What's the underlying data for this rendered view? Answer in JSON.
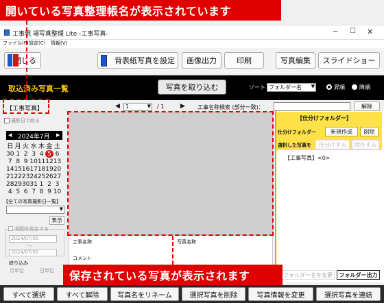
{
  "callouts": {
    "top": "開いている写真整理帳名が表示されています",
    "bottom": "保存されている写真が表示されます"
  },
  "window": {
    "title": "工事現 場写真整理 Lite -工事写真-"
  },
  "menu": [
    "ファイル(F)",
    "設定(C)",
    "情報(V)"
  ],
  "toolbar": {
    "close": "閉じる",
    "set_background": "背表紙写真を設定",
    "image_output": "画像出力",
    "print": "印刷",
    "edit_photo": "写真編集",
    "slideshow": "スライドショー"
  },
  "blackbar": {
    "section_title": "取込済み写真一覧",
    "import_button": "写真を取り込む",
    "sort_label": "ソート",
    "sort_value": "フォルダー名",
    "ascending": "昇順",
    "descending": "降順"
  },
  "filterbar": {
    "album_name": "【工事写真】",
    "page_value": "1",
    "page_total": "/ 1",
    "search_label": "工事名称検索 (部分一致)：",
    "clear_button": "解除"
  },
  "left": {
    "narrow_checkbox": "撮影日で絞る",
    "month": "2024年7月",
    "weekdays": [
      "日",
      "月",
      "火",
      "水",
      "木",
      "金",
      "土"
    ],
    "weeks": [
      [
        "30",
        "1",
        "2",
        "3",
        "4",
        "5",
        "6"
      ],
      [
        "7",
        "8",
        "9",
        "10",
        "11",
        "12",
        "13"
      ],
      [
        "14",
        "15",
        "16",
        "17",
        "18",
        "19",
        "20"
      ],
      [
        "21",
        "22",
        "23",
        "24",
        "25",
        "26",
        "27"
      ],
      [
        "28",
        "29",
        "30",
        "31",
        "1",
        "2",
        "3"
      ],
      [
        "4",
        "5",
        "6",
        "7",
        "8",
        "9",
        "10"
      ]
    ],
    "all_dates_label": "【全ての写真撮影日一覧】",
    "show_button": "表示",
    "period_label": "期間を指定する",
    "date_from": "2024/07/05",
    "tilde": "～",
    "date_to": "2024/07/05",
    "narrow_label": "絞り込み",
    "radio_month": "月単位",
    "radio_day": "日単位"
  },
  "photo_info": {
    "construction_name": "工事名称",
    "photo_name": "写真名称",
    "comment": "コメント"
  },
  "folder": {
    "title": "【仕分けフォルダー】",
    "folder_label": "仕分けフォルダー",
    "new_button": "新規作成",
    "delete_button": "削除",
    "selected_label": "選択した写真を",
    "sort_button": "仕分けする",
    "exclude_button": "除外する",
    "tree_root": "【工事写真】<0>",
    "rename_button": "フォルダー名を変更",
    "output_button": "フォルダー出力"
  },
  "bottom": [
    "すべて選択",
    "すべて解除",
    "写真名をリネーム",
    "選択写真を削除",
    "写真情報を変更",
    "選択写真を連結"
  ],
  "colors": {
    "accent_red": "#e00000",
    "folder_yellow": "#ffe24a",
    "black_bar": "#000000"
  }
}
